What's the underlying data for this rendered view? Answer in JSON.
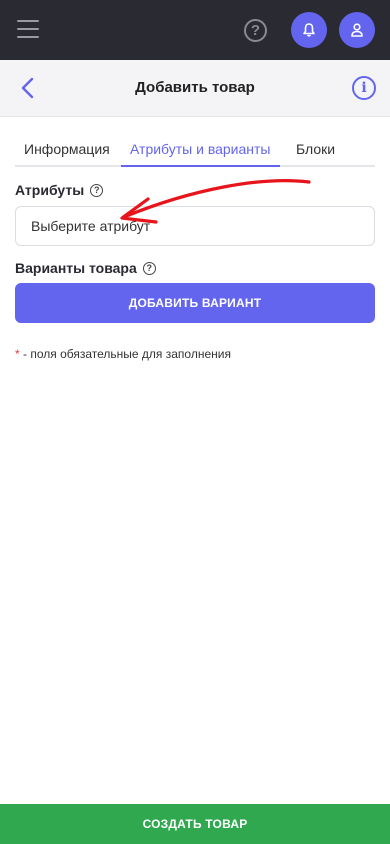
{
  "topbar": {
    "menu_icon": "hamburger-menu-icon",
    "help_icon": "help-circle-icon",
    "help_glyph": "?",
    "notifications_icon": "bell-icon",
    "profile_icon": "user-icon"
  },
  "header": {
    "title": "Добавить товар",
    "back_icon": "chevron-left-icon",
    "info_glyph": "i"
  },
  "tabs": [
    {
      "label": "Информация",
      "active": false
    },
    {
      "label": "Атрибуты и варианты",
      "active": true
    },
    {
      "label": "Блоки",
      "active": false
    }
  ],
  "attributes": {
    "label": "Атрибуты",
    "help_glyph": "?",
    "select_placeholder": "Выберите атрибут"
  },
  "variants": {
    "label": "Варианты товара",
    "help_glyph": "?",
    "add_button": "ДОБАВИТЬ ВАРИАНТ"
  },
  "required_note": {
    "star": "*",
    "text": " - поля обязательные для заполнения"
  },
  "footer": {
    "create_button": "СОЗДАТЬ ТОВАР"
  },
  "colors": {
    "topbar": "#2a2a33",
    "accent": "#6365ef",
    "create": "#2fa84f",
    "annotation_arrow": "#e8141b"
  }
}
